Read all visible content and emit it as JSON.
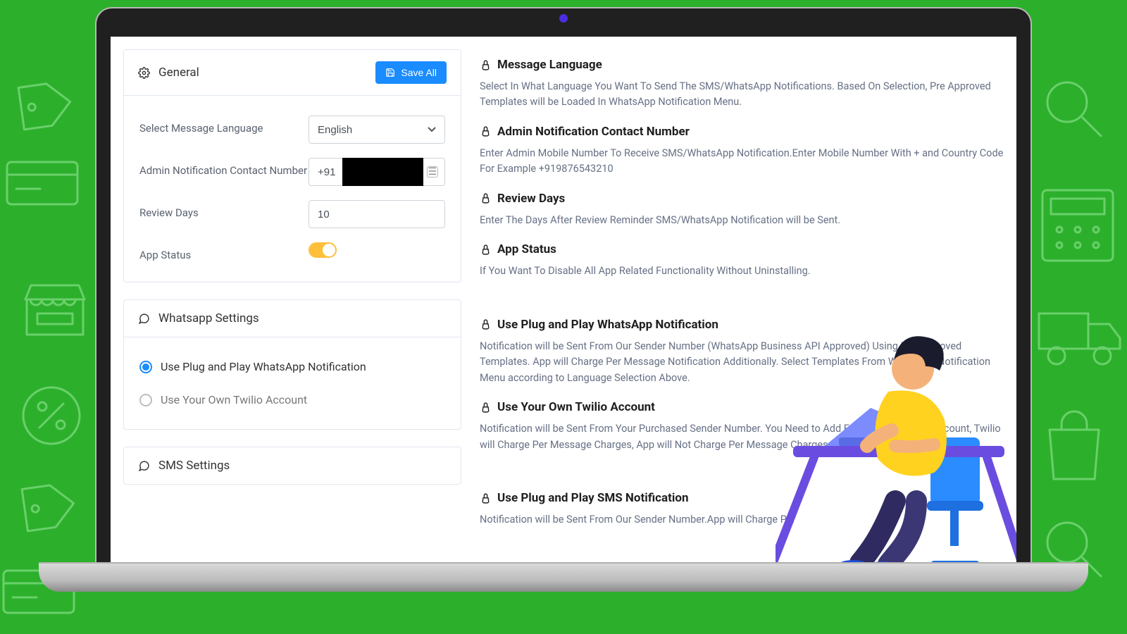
{
  "general": {
    "title": "General",
    "save": "Save All",
    "fields": {
      "language_label": "Select Message Language",
      "language_value": "English",
      "admin_label": "Admin Notification Contact Number",
      "admin_value": "+91",
      "review_label": "Review Days",
      "review_value": "10",
      "status_label": "App Status"
    }
  },
  "whatsapp": {
    "title": "Whatsapp Settings",
    "opt1": "Use Plug and Play WhatsApp Notification",
    "opt2": "Use Your Own Twilio Account"
  },
  "sms": {
    "title": "SMS Settings"
  },
  "help": {
    "h1": "Message Language",
    "p1": "Select In What Language You Want To Send The SMS/WhatsApp Notifications. Based On Selection, Pre Approved Templates will be Loaded In WhatsApp Notification Menu.",
    "h2": "Admin Notification Contact Number",
    "p2": "Enter Admin Mobile Number To Receive SMS/WhatsApp Notification.Enter Mobile Number With + and Country Code For Example +919876543210",
    "h3": "Review Days",
    "p3": "Enter The Days After Review Reminder SMS/WhatsApp Notification will be Sent.",
    "h4": "App Status",
    "p4": "If You Want To Disable All App Related Functionality Without Uninstalling.",
    "h5": "Use Plug and Play WhatsApp Notification",
    "p5": "Notification will be Sent From Our Sender Number (WhatsApp Business API Approved) Using Pre Approved Templates. App will Charge Per Message Notification Additionally. Select Templates From WhatsApp Notification Menu according to Language Selection Above.",
    "h6": "Use Your Own Twilio Account",
    "p6": "Notification will be Sent From Your Purchased Sender Number. You Need to Add Fund in Your Twilio Account, Twilio will Charge Per Message Charges, App will Not Charge Per Message Charges if This Option Selected.",
    "h7": "Use Plug and Play SMS Notification",
    "p7": "Notification will be Sent From Our Sender Number.App will Charge Per"
  }
}
